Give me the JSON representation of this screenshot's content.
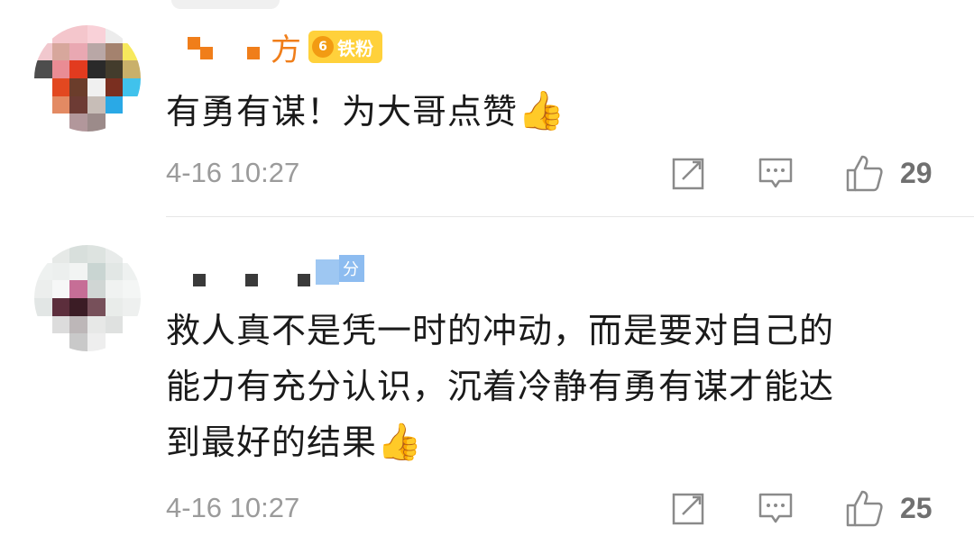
{
  "comments": [
    {
      "username_suffix": "方",
      "badge_level": "6",
      "badge_label": "铁粉",
      "text": "有勇有谋！为大哥点赞",
      "emoji": "👍",
      "timestamp": "4-16 10:27",
      "icons": [
        "share-icon",
        "comment-icon",
        "like-icon"
      ],
      "likes": "29"
    },
    {
      "username_suffix": "分",
      "text_lines": [
        "救人真不是凭一时的冲动，而是要对自己的",
        "能力有充分认识，沉着冷静有勇有谋才能达",
        "到最好的结果"
      ],
      "emoji": "👍",
      "timestamp": "4-16 10:27",
      "icons": [
        "share-icon",
        "comment-icon",
        "like-icon"
      ],
      "likes": "25"
    }
  ],
  "colors": {
    "username": "#f07e1a",
    "badge": "#ffd13b",
    "text": "#1a1a1a",
    "meta": "#9b9b9b"
  }
}
